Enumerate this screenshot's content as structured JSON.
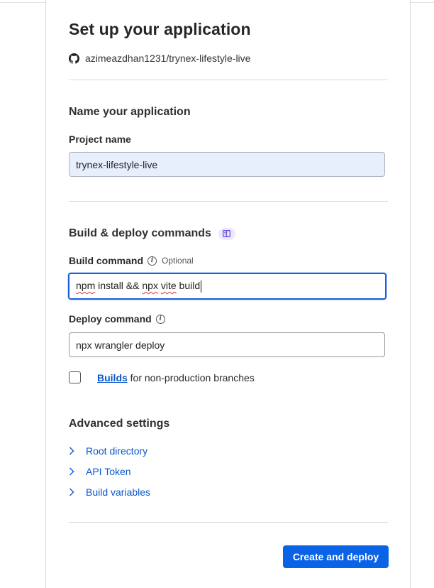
{
  "page": {
    "title": "Set up your application",
    "repo": {
      "icon": "github-icon",
      "name": "azimeazdhan1231/trynex-lifestyle-live"
    }
  },
  "name_section": {
    "heading": "Name your application",
    "project_label": "Project name",
    "project_value": "trynex-lifestyle-live"
  },
  "build_section": {
    "heading": "Build & deploy commands",
    "badge_icon": "docs-book-icon",
    "build_label": "Build command",
    "build_optional": "Optional",
    "build_value_parts": [
      "npm",
      " install && ",
      "npx",
      " ",
      "vite",
      " build"
    ],
    "deploy_label": "Deploy command",
    "deploy_value": "npx wrangler deploy",
    "checkbox": {
      "checked": false,
      "link_text": "Builds",
      "text": " for non-production branches"
    }
  },
  "advanced": {
    "heading": "Advanced settings",
    "items": [
      "Root directory",
      "API Token",
      "Build variables"
    ]
  },
  "actions": {
    "primary_label": "Create and deploy"
  },
  "colors": {
    "accent": "#0a63e7",
    "link": "#0b57c9",
    "filled_input": "#e8effc"
  }
}
